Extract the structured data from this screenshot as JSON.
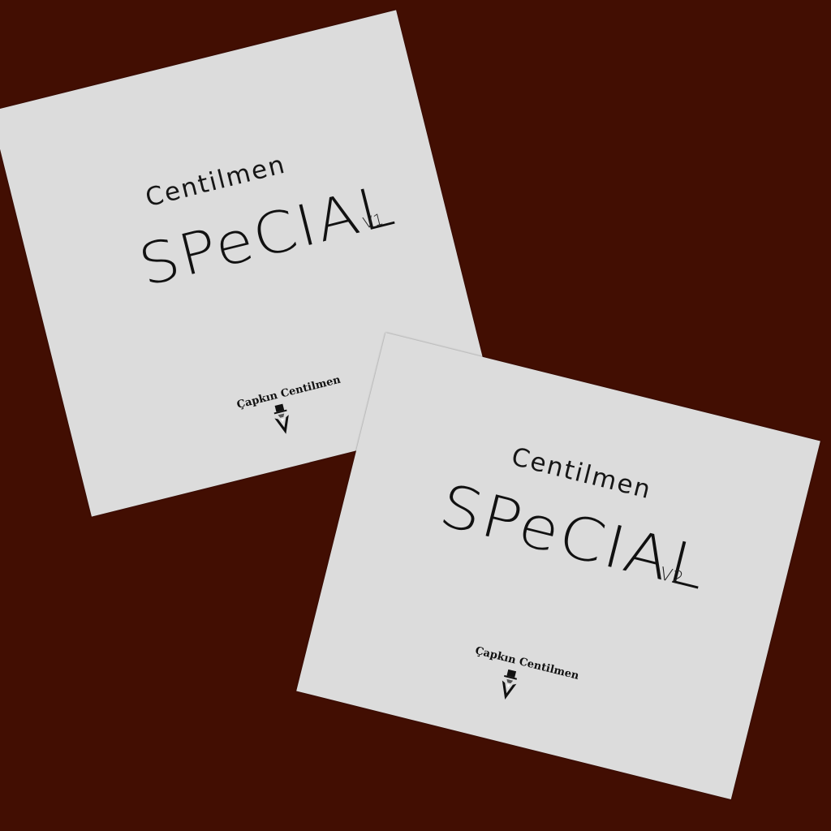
{
  "background_color": "#420e02",
  "card_color": "#dcdcdc",
  "cards": [
    {
      "title": "Centilmen",
      "special": "SPeCIAL",
      "version": "V1",
      "brand": "Çapkın Centilmen",
      "logo_icon": "gentleman-top-hat-icon"
    },
    {
      "title": "Centilmen",
      "special": "SPeCIAL",
      "version": "V2",
      "brand": "Çapkın Centilmen",
      "logo_icon": "gentleman-top-hat-icon"
    }
  ]
}
